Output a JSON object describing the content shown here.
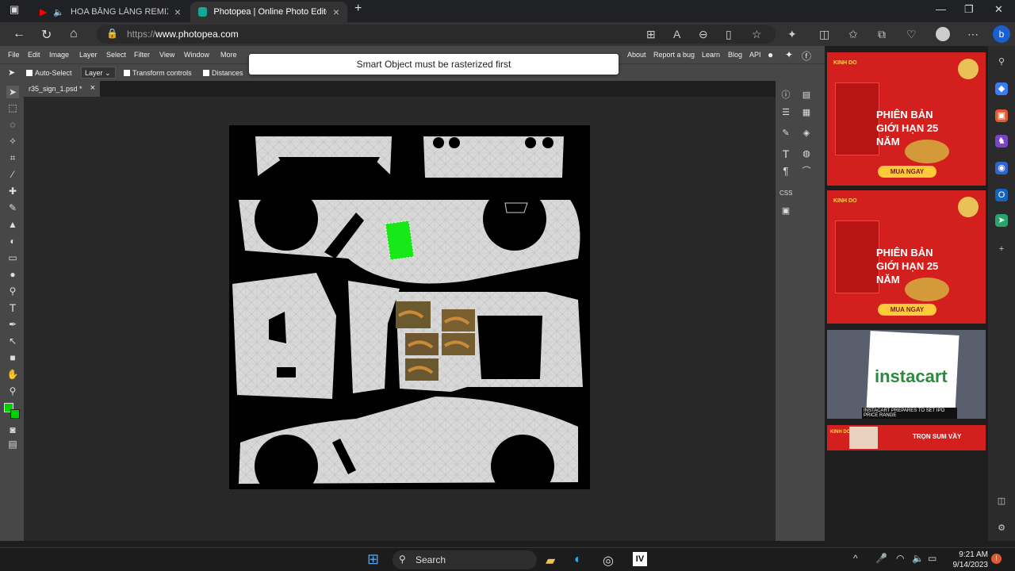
{
  "browser": {
    "tabs": [
      {
        "title": "HOA BẰNG LĂNG REMIX - S",
        "icon": "youtube-icon"
      },
      {
        "title": "Photopea | Online Photo Editor",
        "icon": "photopea-icon"
      }
    ],
    "url_prefix": "https://",
    "url_domain": "www.photopea.com"
  },
  "menu": [
    "File",
    "Edit",
    "Image",
    "Layer",
    "Select",
    "Filter",
    "View",
    "Window",
    "More"
  ],
  "menu_right": [
    "About",
    "Report a bug",
    "Learn",
    "Blog",
    "API"
  ],
  "options": {
    "auto_select": "Auto-Select",
    "layer_select": "Layer",
    "transform_controls": "Transform controls",
    "distances": "Distances"
  },
  "toast": "Smart Object must be rasterized first",
  "document_tab": "r35_sign_1.psd *",
  "colors": {
    "foreground": "#00d000",
    "background": "#00d000",
    "selection": "#18e818"
  },
  "ads": [
    {
      "brand": "KINH DO",
      "title": "PHIÊN BẢN GIỚI HẠN 25 NĂM",
      "cta": "MUA NGAY"
    },
    {
      "brand": "KINH DO",
      "title": "PHIÊN BẢN GIỚI HẠN 25 NĂM",
      "cta": "MUA NGAY"
    },
    {
      "brand": "instacart",
      "caption": "INSTACART PREPARES TO SET IPO PRICE RANGE"
    },
    {
      "brand": "KINH DO",
      "banner": "TRỌN SUM VẦY"
    }
  ],
  "taskbar": {
    "search": "Search",
    "time": "9:21 AM",
    "date": "9/14/2023"
  }
}
